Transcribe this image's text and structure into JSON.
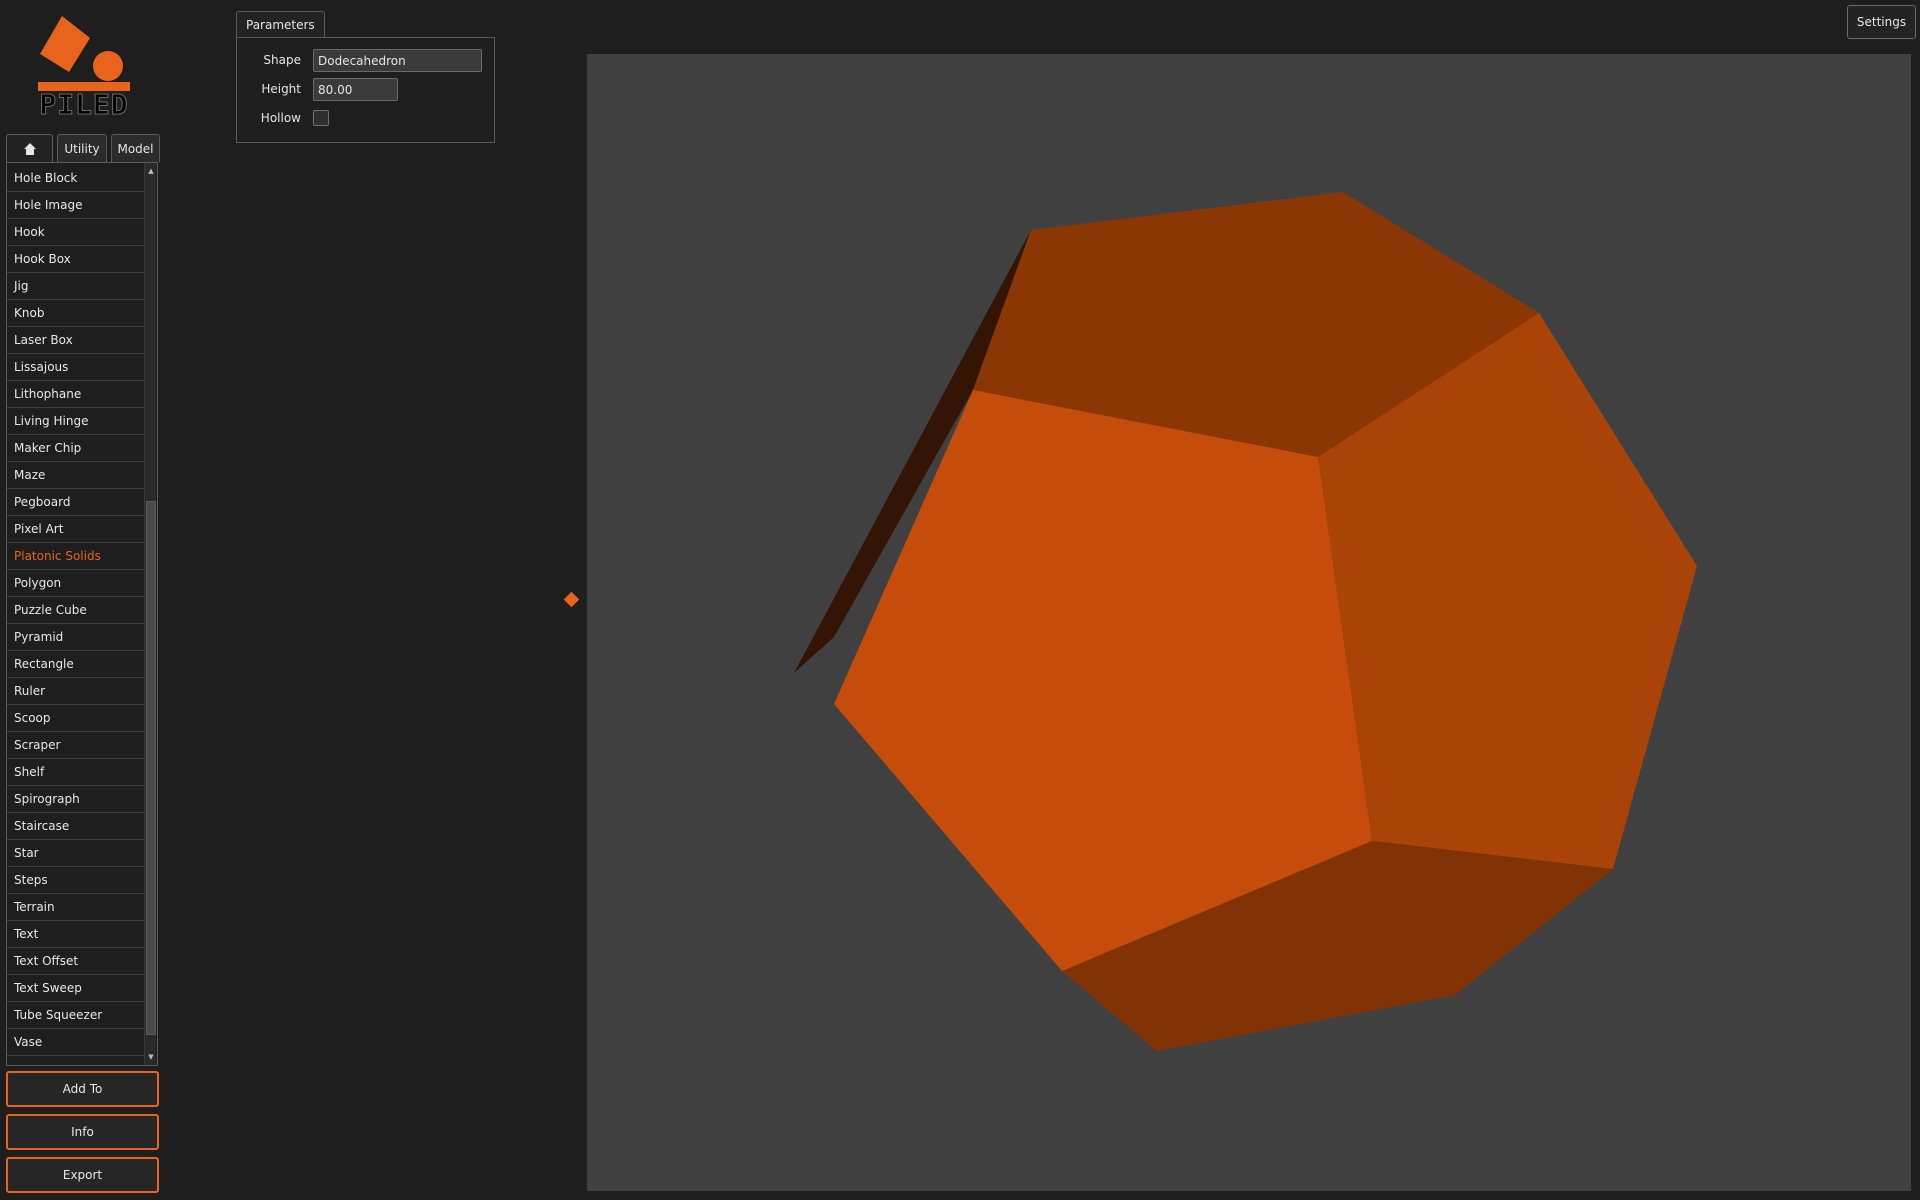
{
  "app": {
    "brand": "PILED"
  },
  "tabs": {
    "home_icon": "home-icon",
    "utility": "Utility",
    "model": "Model"
  },
  "list": {
    "items": [
      "Hole Block",
      "Hole Image",
      "Hook",
      "Hook Box",
      "Jig",
      "Knob",
      "Laser Box",
      "Lissajous",
      "Lithophane",
      "Living Hinge",
      "Maker Chip",
      "Maze",
      "Pegboard",
      "Pixel Art",
      "Platonic Solids",
      "Polygon",
      "Puzzle Cube",
      "Pyramid",
      "Rectangle",
      "Ruler",
      "Scoop",
      "Scraper",
      "Shelf",
      "Spirograph",
      "Staircase",
      "Star",
      "Steps",
      "Terrain",
      "Text",
      "Text Offset",
      "Text Sweep",
      "Tube Squeezer",
      "Vase"
    ],
    "selected": "Platonic Solids"
  },
  "actions": {
    "add_to": "Add To",
    "info": "Info",
    "export": "Export"
  },
  "parameters": {
    "tab_label": "Parameters",
    "shape_label": "Shape",
    "shape_value": "Dodecahedron",
    "height_label": "Height",
    "height_value": "80.00",
    "hollow_label": "Hollow",
    "hollow_checked": false
  },
  "settings": {
    "label": "Settings"
  },
  "colors": {
    "accent": "#e8641c",
    "background": "#1e1e1e",
    "viewport": "#404040",
    "face_front": "#c54c0b",
    "face_right": "#a94308",
    "face_top": "#8b3705",
    "face_bottom": "#823305",
    "face_edge": "#341404"
  }
}
